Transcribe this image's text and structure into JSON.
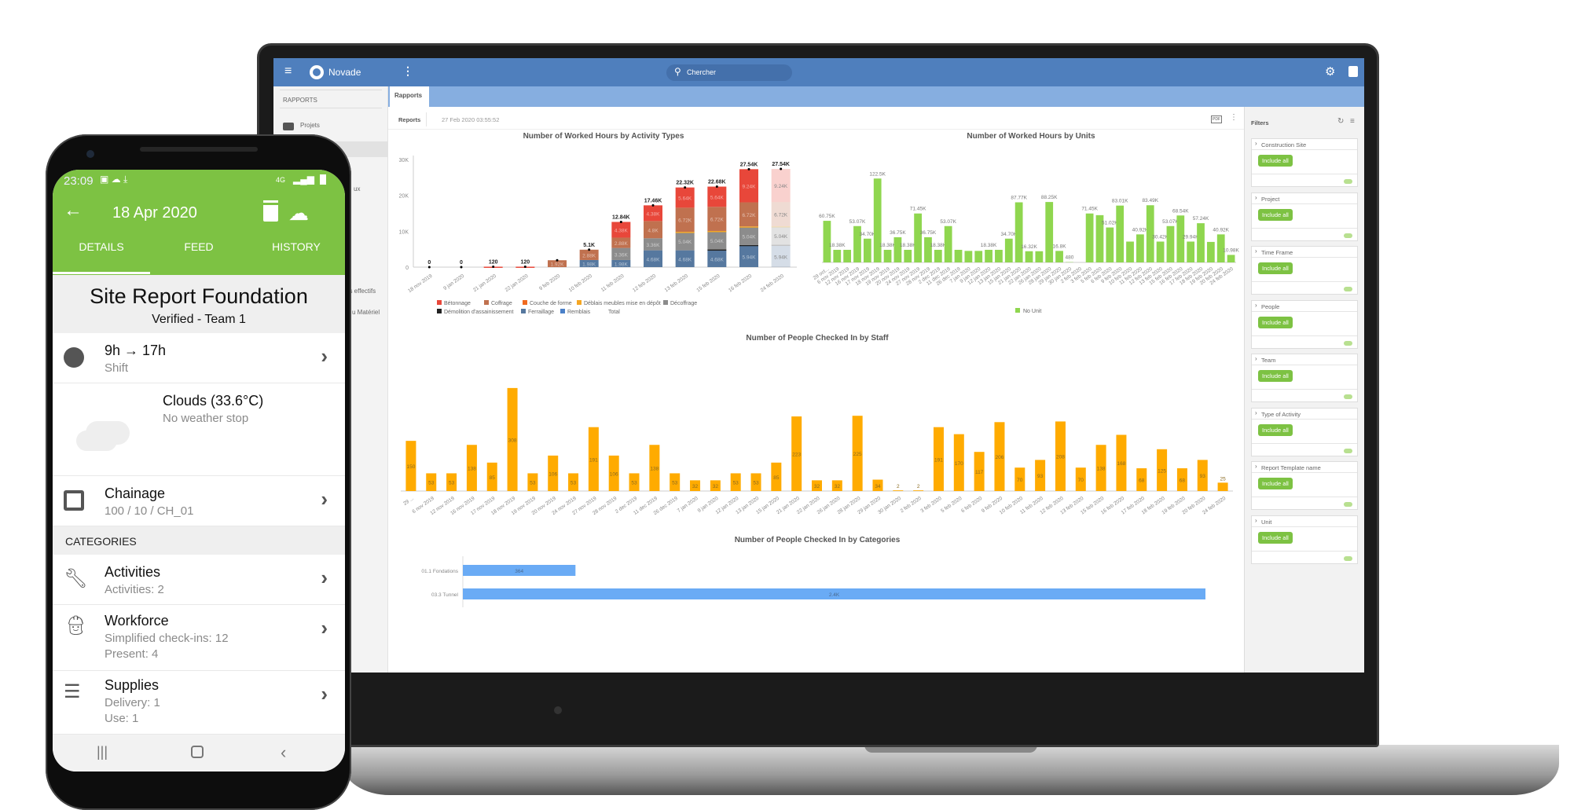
{
  "phone": {
    "status": {
      "time": "23:09",
      "network": "4G"
    },
    "header": {
      "title": "18 Apr 2020"
    },
    "tabs": [
      {
        "label": "DETAILS",
        "active": true
      },
      {
        "label": "FEED"
      },
      {
        "label": "HISTORY"
      }
    ],
    "report": {
      "title": "Site Report Foundation",
      "subtitle": "Verified - Team 1"
    },
    "shift": {
      "title": "9h → 17h",
      "subtitle": "Shift"
    },
    "weather": {
      "title": "Clouds (33.6°C)",
      "subtitle": "No weather stop"
    },
    "chainage": {
      "title": "Chainage",
      "subtitle": "100 / 10 / CH_01"
    },
    "categories_header": "CATEGORIES",
    "activities": {
      "title": "Activities",
      "subtitle": "Activities: 2"
    },
    "workforce": {
      "title": "Workforce",
      "line1": "Simplified check-ins: 12",
      "line2": "Present: 4"
    },
    "supplies": {
      "title": "Supplies",
      "line1": "Delivery: 1",
      "line2": "Use: 1"
    },
    "accent": "#7dc243"
  },
  "app": {
    "brand": "Novade",
    "search_placeholder": "Chercher",
    "tab": "Rapports",
    "sidebar": {
      "section": "RAPPORTS",
      "items": [
        "Projets",
        "ux",
        "es effectifs",
        "u Matériel"
      ]
    },
    "reports_label": "Reports",
    "timestamp": "27 Feb 2020 03:55:52",
    "pdf_label": "PDF",
    "accent": "#4f7fbd",
    "filters": {
      "title": "Filters",
      "include_label": "Include all",
      "groups": [
        "Construction Site",
        "Project",
        "Time Frame",
        "People",
        "Team",
        "Type of Activity",
        "Report Template name",
        "Unit"
      ]
    }
  },
  "chart_data": [
    {
      "type": "bar",
      "stacked": true,
      "title": "Number of Worked Hours by Activity Types",
      "categories": [
        "18 nov 2019",
        "9 jan 2020",
        "21 jan 2020",
        "22 jan 2020",
        "9 feb 2020",
        "10 feb 2020",
        "11 feb 2020",
        "12 feb 2020",
        "13 feb 2020",
        "15 feb 2020",
        "16 feb 2020",
        "24 feb 2020"
      ],
      "ylim": [
        0,
        30000
      ],
      "yticks": [
        "0",
        "10K",
        "20K",
        "30K"
      ],
      "totals": [
        "0",
        "0",
        "120",
        "120",
        "",
        "5.1K",
        "12.84K",
        "17.46K",
        "22.32K",
        "22.68K",
        "27.54K",
        "27.54K"
      ],
      "series": [
        {
          "name": "Ferraillage",
          "color": "#56789f",
          "values": [
            0,
            0,
            0,
            0,
            0,
            1980,
            1980,
            4680,
            4680,
            4680,
            5940,
            5940
          ],
          "labels": [
            "",
            "",
            "",
            "",
            "",
            "1.98K",
            "1.98K",
            "4.68K",
            "4.68K",
            "4.68K",
            "5.94K",
            "5.94K"
          ]
        },
        {
          "name": "Démolition d'assainissement",
          "color": "#222222",
          "values": [
            0,
            0,
            0,
            0,
            0,
            0,
            0,
            0,
            0,
            240,
            240,
            300
          ],
          "labels": [
            "",
            "",
            "",
            "",
            "",
            "",
            "",
            "",
            "0",
            "240",
            "240",
            "300"
          ]
        },
        {
          "name": "Décoffrage",
          "color": "#8c8c8c",
          "values": [
            0,
            0,
            0,
            0,
            0,
            0,
            3360,
            3360,
            5040,
            5040,
            5040,
            5040
          ],
          "labels": [
            "",
            "",
            "",
            "",
            "",
            "",
            "3.36K",
            "3.36K",
            "5.04K",
            "5.04K",
            "5.04K",
            "5.04K"
          ]
        },
        {
          "name": "Déblais meubles mise en dépôt",
          "color": "#f5a623",
          "values": [
            0,
            0,
            0,
            0,
            0,
            0,
            0,
            0,
            120,
            120,
            120,
            120
          ],
          "labels": [
            "",
            "",
            "",
            "",
            "",
            "",
            "",
            "",
            "120",
            "120",
            "120",
            "120"
          ]
        },
        {
          "name": "Coffrage",
          "color": "#c0714f",
          "values": [
            0,
            0,
            0,
            0,
            1920,
            2880,
            2880,
            4800,
            6720,
            6720,
            6720,
            6720
          ],
          "labels": [
            "",
            "",
            "",
            "",
            "1.92K",
            "2.88K",
            "2.88K",
            "4.8K",
            "6.72K",
            "6.72K",
            "6.72K",
            "6.72K"
          ]
        },
        {
          "name": "Bétonnage",
          "color": "#e8473a",
          "values": [
            0,
            0,
            120,
            120,
            0,
            0,
            4380,
            4380,
            5640,
            5640,
            9240,
            9240
          ],
          "labels": [
            "",
            "",
            "",
            "",
            "",
            "",
            "4.38K",
            "4.38K",
            "5.64K",
            "5.64K",
            "9.24K",
            "9.24K"
          ]
        },
        {
          "name": "Couche de forme",
          "color": "#f06a1f",
          "values": [
            0,
            0,
            0,
            0,
            0,
            0,
            0,
            0,
            0,
            0,
            0,
            0
          ]
        },
        {
          "name": "Remblais",
          "color": "#4a80c8",
          "values": [
            0,
            0,
            0,
            0,
            0,
            0,
            0,
            0,
            0,
            0,
            0,
            0
          ]
        }
      ],
      "legend": [
        "Bétonnage",
        "Coffrage",
        "Couche de forme",
        "Déblais meubles mise en dépôt",
        "Décoffrage",
        "Démolition d'assainissement",
        "Ferraillage",
        "Remblais",
        "Total"
      ],
      "legend_placement": "bottom",
      "highlighted_category": "16 feb 2020"
    },
    {
      "type": "bar",
      "title": "Number of Worked Hours by Units",
      "color": "#8fd64f",
      "legend": [
        "No Unit"
      ],
      "legend_placement": "bottom",
      "categories": [
        "29 oct...",
        "6 nov 2019",
        "12 nov 2019",
        "16 nov 2019",
        "17 nov 2019",
        "18 nov 2019",
        "19 nov 2019",
        "20 nov 2019",
        "24 nov 2019",
        "27 nov 2019",
        "28 nov 2019",
        "2 dec 2019",
        "11 dec 2019",
        "26 dec 2019",
        "7 jan 2020",
        "9 jan 2020",
        "12 jan 2020",
        "13 jan 2020",
        "15 jan 2020",
        "21 jan 2020",
        "22 jan 2020",
        "26 jan 2020",
        "28 jan 2020",
        "29 jan 2020",
        "30 jan 2020",
        "2 feb 2020",
        "3 feb 2020",
        "5 feb 2020",
        "6 feb 2020",
        "9 feb 2020",
        "10 feb 2020",
        "11 feb 2020",
        "12 feb 2020",
        "13 feb 2020",
        "15 feb 2020",
        "16 feb 2020",
        "17 feb 2020",
        "18 feb 2020",
        "19 feb 2020",
        "20 feb 2020",
        "24 feb 2020"
      ],
      "values": [
        60750,
        18380,
        18380,
        53070,
        34700,
        122500,
        18380,
        36750,
        18380,
        71450,
        36750,
        18380,
        53070,
        18380,
        16800,
        16800,
        18380,
        18380,
        34700,
        87770,
        16320,
        16320,
        88250,
        16800,
        480,
        0,
        71450,
        69000,
        51020,
        83010,
        30420,
        40920,
        83490,
        30420,
        53070,
        68540,
        30420,
        57240,
        29940,
        40920,
        10980
      ],
      "labels": [
        "60.75K",
        "18.38K",
        "",
        "53.07K",
        "34.70K",
        "122.5K",
        "18.38K",
        "36.75K",
        "18.38K",
        "71.45K",
        "36.75K",
        "18.38K",
        "53.07K",
        "",
        "",
        "",
        "18.38K",
        "",
        "34.70K",
        "87.77K",
        "16.32K",
        "",
        "88.25K",
        "16.8K",
        "480",
        "",
        "71.45K",
        "",
        "51.02K",
        "83.01K",
        "",
        "40.92K",
        "83.49K",
        "30.42K",
        "53.07K",
        "68.54K",
        "29.94K",
        "57.24K",
        "",
        "40.92K",
        "10.98K"
      ],
      "ylim": [
        0,
        140000
      ]
    },
    {
      "type": "bar",
      "title": "Number of People Checked In by Staff",
      "color": "#ffab00",
      "categories": [
        "29 ...",
        "6 nov 2019",
        "12 nov 2019",
        "16 nov 2019",
        "17 nov 2019",
        "18 nov 2019",
        "19 nov 2019",
        "20 nov 2019",
        "24 nov 2019",
        "27 nov 2019",
        "28 nov 2019",
        "2 dec 2019",
        "11 dec 2019",
        "26 dec 2019",
        "7 jan 2020",
        "9 jan 2020",
        "12 jan 2020",
        "13 jan 2020",
        "15 jan 2020",
        "21 jan 2020",
        "22 jan 2020",
        "26 jan 2020",
        "28 jan 2020",
        "29 jan 2020",
        "30 jan 2020",
        "2 feb 2020",
        "3 feb 2020",
        "5 feb 2020",
        "6 feb 2020",
        "9 feb 2020",
        "10 feb 2020",
        "11 feb 2020",
        "12 feb 2020",
        "13 feb 2020",
        "15 feb 2020",
        "16 feb 2020",
        "17 feb 2020",
        "18 feb 2020",
        "19 feb 2020",
        "20 feb 2020",
        "24 feb 2020"
      ],
      "values": [
        150,
        53,
        53,
        138,
        85,
        308,
        53,
        106,
        53,
        191,
        106,
        53,
        138,
        53,
        32,
        32,
        53,
        53,
        85,
        223,
        32,
        32,
        225,
        34,
        2,
        2,
        191,
        170,
        117,
        206,
        70,
        93,
        208,
        70,
        138,
        168,
        68,
        125,
        68,
        93,
        25
      ],
      "ylim": [
        0,
        350
      ]
    },
    {
      "type": "bar",
      "orientation": "horizontal",
      "title": "Number of People Checked In by Categories",
      "color": "#6aabf5",
      "categories": [
        "01.1 Fondations",
        "03.3 Tunnel"
      ],
      "values": [
        364,
        2400
      ],
      "labels": [
        "364",
        "2.4K"
      ],
      "xlim": [
        0,
        2400
      ]
    }
  ]
}
